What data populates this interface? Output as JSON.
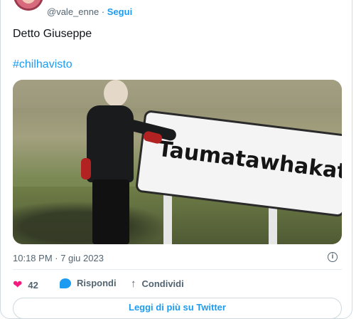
{
  "author": {
    "handle": "@vale_enne",
    "follow_label": "Segui",
    "avatar_icon": "profile-avatar"
  },
  "tweet": {
    "text": "Detto Giuseppe",
    "hashtag": "#chilhavisto",
    "media": {
      "sign_text": "Taumatawhakat"
    },
    "timestamp": "10:18 PM · 7 giu 2023"
  },
  "actions": {
    "likes_count": "42",
    "reply_label": "Rispondi",
    "share_label": "Condividi"
  },
  "read_more_label": "Leggi di più su Twitter",
  "colors": {
    "accent": "#1d9bf0",
    "like": "#f91880",
    "muted": "#536471"
  }
}
